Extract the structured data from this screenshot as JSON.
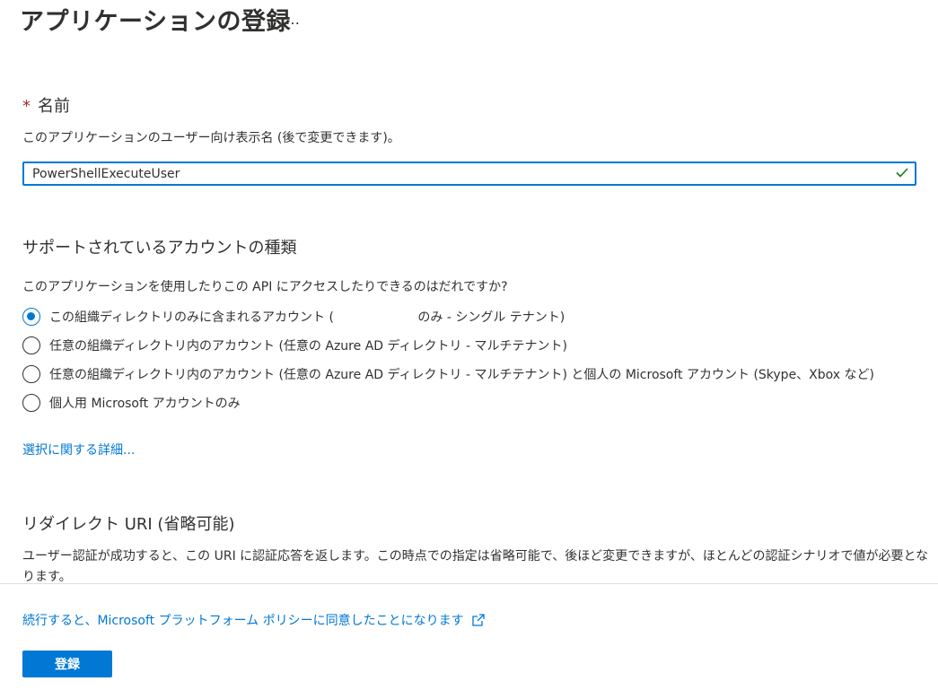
{
  "header": {
    "title": "アプリケーションの登録",
    "more_label": "…"
  },
  "name_section": {
    "required_mark": "*",
    "label": "名前",
    "description": "このアプリケーションのユーザー向け表示名 (後で変更できます)。",
    "input_value": "PowerShellExecuteUser",
    "valid_icon": "checkmark-icon"
  },
  "account_section": {
    "title": "サポートされているアカウントの種類",
    "question": "このアプリケーションを使用したりこの API にアクセスしたりできるのはだれですか?",
    "options": [
      {
        "label": "この組織ディレクトリのみに含まれるアカウント (                     のみ - シングル テナント)",
        "selected": true
      },
      {
        "label": "任意の組織ディレクトリ内のアカウント (任意の Azure AD ディレクトリ - マルチテナント)",
        "selected": false
      },
      {
        "label": "任意の組織ディレクトリ内のアカウント (任意の Azure AD ディレクトリ - マルチテナント) と個人の Microsoft アカウント (Skype、Xbox など)",
        "selected": false
      },
      {
        "label": "個人用 Microsoft アカウントのみ",
        "selected": false
      }
    ],
    "details_link": "選択に関する詳細..."
  },
  "redirect_section": {
    "title": "リダイレクト URI (省略可能)",
    "description_line1": "ユーザー認証が成功すると、この URI に認証応答を返します。この時点での指定は省略可能で、後ほど変更できますが、ほとんどの認証シナリオで値が必要とな",
    "description_line2": "ります。"
  },
  "footer": {
    "policy_link": "続行すると、Microsoft プラットフォーム ポリシーに同意したことになります",
    "policy_icon": "external-link-icon",
    "register_label": "登録"
  },
  "colors": {
    "accent": "#0078d4",
    "required": "#a4262c",
    "valid": "#107c10"
  }
}
